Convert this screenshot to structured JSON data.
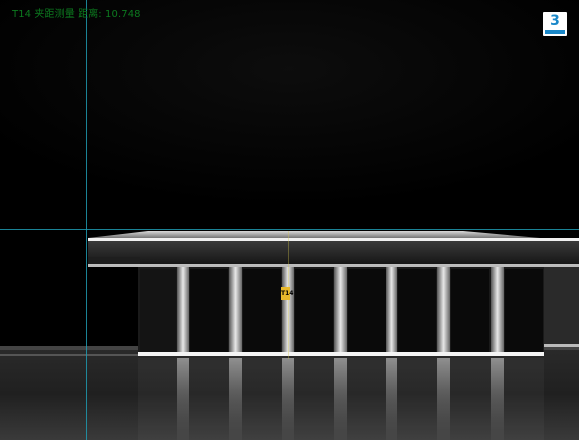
{
  "overlay": {
    "measurement_text": "T14 夹距测量 距离: 10.748",
    "camera_number": "3",
    "part_tag": "T14"
  },
  "colors": {
    "overlay_text": "#0c7a1f",
    "crosshair": "#1f9ab0",
    "badge_accent": "#1a88c9"
  }
}
